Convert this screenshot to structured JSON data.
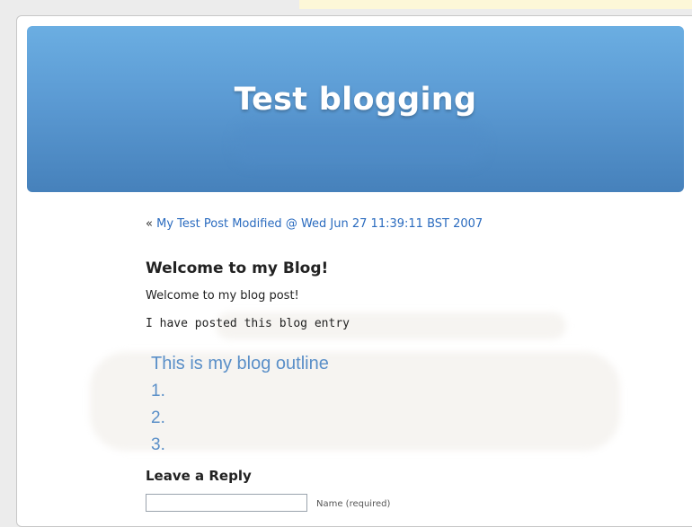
{
  "header": {
    "title": "Test blogging"
  },
  "navigation": {
    "prev_arrow": "«",
    "prev_link": "My Test Post Modified @ Wed Jun 27 11:39:11 BST 2007"
  },
  "post": {
    "title": "Welcome to my Blog!",
    "paragraphs": [
      "Welcome to my blog post!",
      "I have posted this blog entry"
    ],
    "outline": {
      "heading": "This is my blog outline",
      "items": [
        "1.",
        "2.",
        "3."
      ]
    }
  },
  "reply": {
    "heading": "Leave a Reply",
    "name_value": "",
    "name_label": "Name (required)"
  },
  "colors": {
    "banner_top": "#6baee2",
    "banner_bottom": "#4681bb",
    "link": "#2a6bbf",
    "outline": "#5a8fc8"
  }
}
